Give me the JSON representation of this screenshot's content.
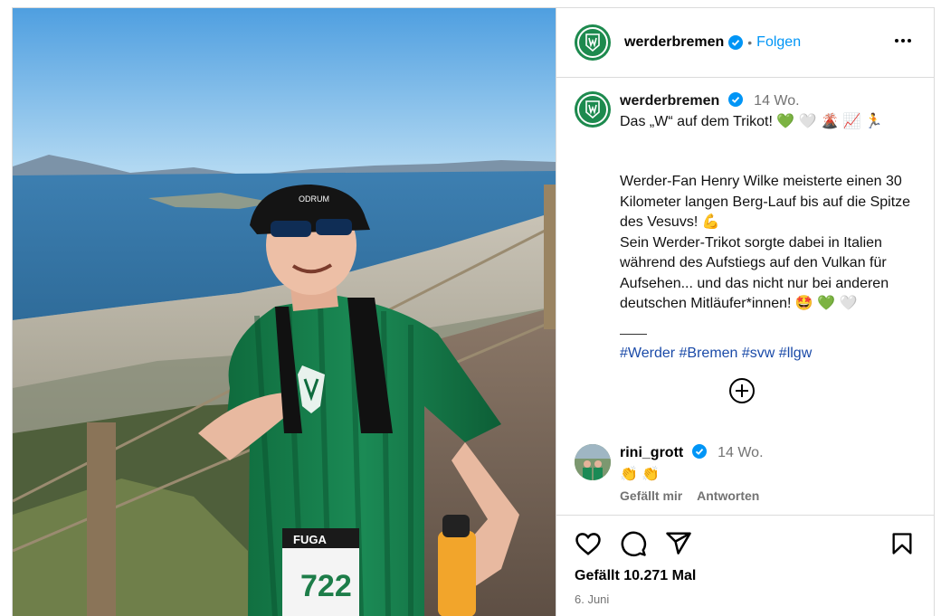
{
  "header": {
    "username": "werderbremen",
    "separator": "•",
    "follow_label": "Folgen"
  },
  "caption": {
    "username": "werderbremen",
    "time": "14 Wo.",
    "lines": [
      "Das „W“ auf dem Trikot! 💚 🤍 🌋 📈 🏃",
      "",
      "Werder-Fan Henry Wilke meisterte einen 30 Kilometer langen Berg-Lauf bis auf die Spitze des Vesuvs! 💪",
      "Sein Werder-Trikot sorgte dabei in Italien während des Aufstiegs auf den Vulkan für Aufsehen... und das nicht nur bei anderen deutschen Mitläufer*innen! 🤩 💚 🤍"
    ],
    "hashtags": [
      "#Werder",
      "#Bremen",
      "#svw",
      "#llgw"
    ]
  },
  "comment": {
    "username": "rini_grott",
    "time": "14 Wo.",
    "text": "👏 👏",
    "like_label": "Gefällt mir",
    "reply_label": "Antworten"
  },
  "footer": {
    "likes_text": "Gefällt 10.271 Mal",
    "date": "6. Juni"
  },
  "media": {
    "bib_brand": "FUGA",
    "bib_number": "722",
    "cap_text": "ODRUM"
  },
  "icons": {
    "more": "more-icon",
    "verified": "verified-icon",
    "load_more": "plus-circle-icon",
    "like": "heart-icon",
    "comment": "comment-icon",
    "share": "share-icon",
    "save": "bookmark-icon"
  },
  "colors": {
    "brand_green": "#1d8a4e",
    "link_blue": "#0095f6",
    "hashtag_blue": "#1a4aa8",
    "verified_blue": "#0095f6",
    "muted": "#737373"
  }
}
